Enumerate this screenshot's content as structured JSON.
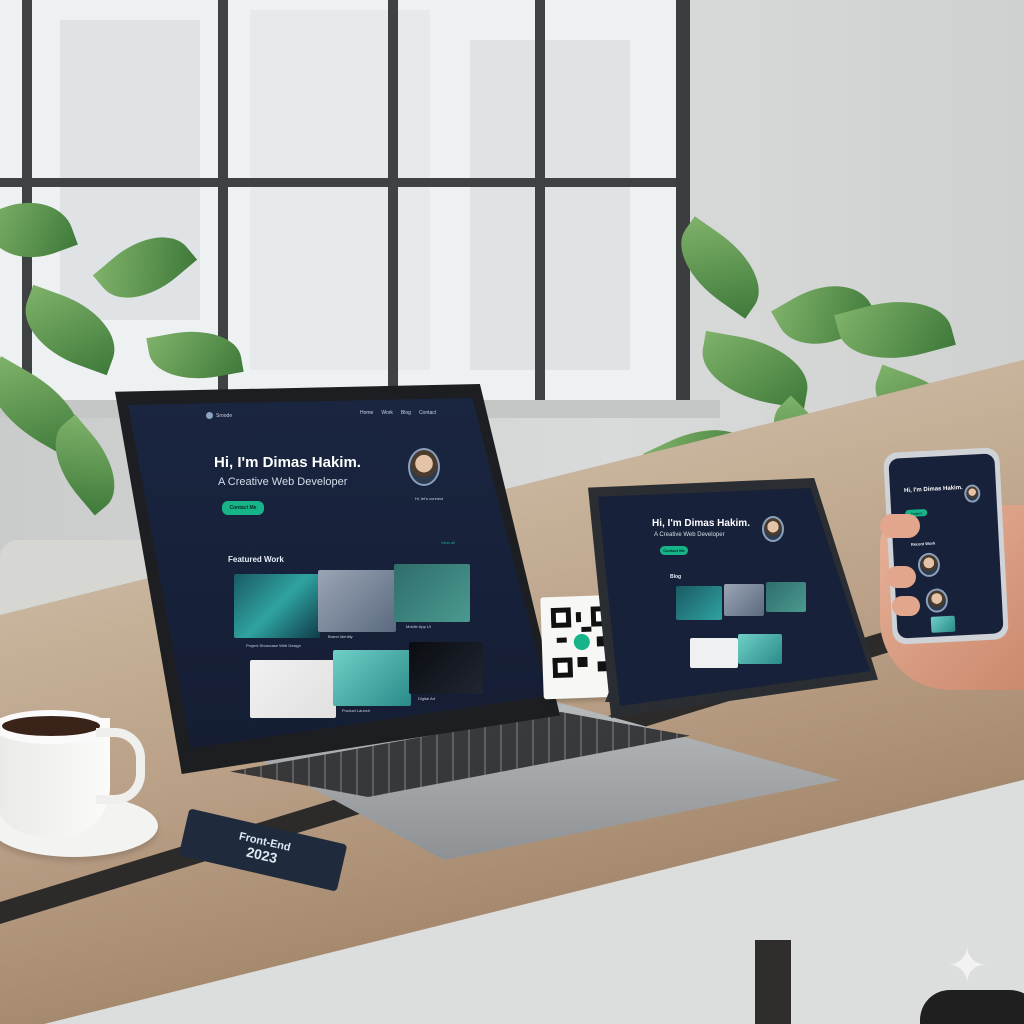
{
  "laptop_site": {
    "logo": "Sroode",
    "nav": [
      "Home",
      "Work",
      "Blog",
      "Contact"
    ],
    "hero_title": "Hi, I'm Dimas Hakim.",
    "hero_subtitle": "A Creative Web Developer",
    "cta_label": "Contact Me",
    "avatar_caption": "Hi, let's connect",
    "section_title": "Featured Work",
    "view_all": "View all",
    "project_captions": [
      "Project Showcase Web Design",
      "Brand Identity",
      "Mobile App UI",
      "Creative Portfolio Site",
      "Product Launch",
      "Digital Art"
    ]
  },
  "tablet_site": {
    "hero_title": "Hi, I'm Dimas Hakim.",
    "hero_subtitle": "A Creative Web Developer",
    "cta_label": "Contact Me",
    "section_title": "Blog"
  },
  "phone_site": {
    "hero_title": "Hi, I'm Dimas Hakim.",
    "cta_label": "Contact",
    "list_title": "Recent Work"
  },
  "tag": {
    "line1": "Front-End",
    "year": "2023"
  },
  "colors": {
    "site_bg": "#18213a",
    "accent": "#17b48a",
    "desk": "#b89e84"
  },
  "icons": {
    "sparkle": "sparkle-icon",
    "qr": "qr-code-icon"
  }
}
